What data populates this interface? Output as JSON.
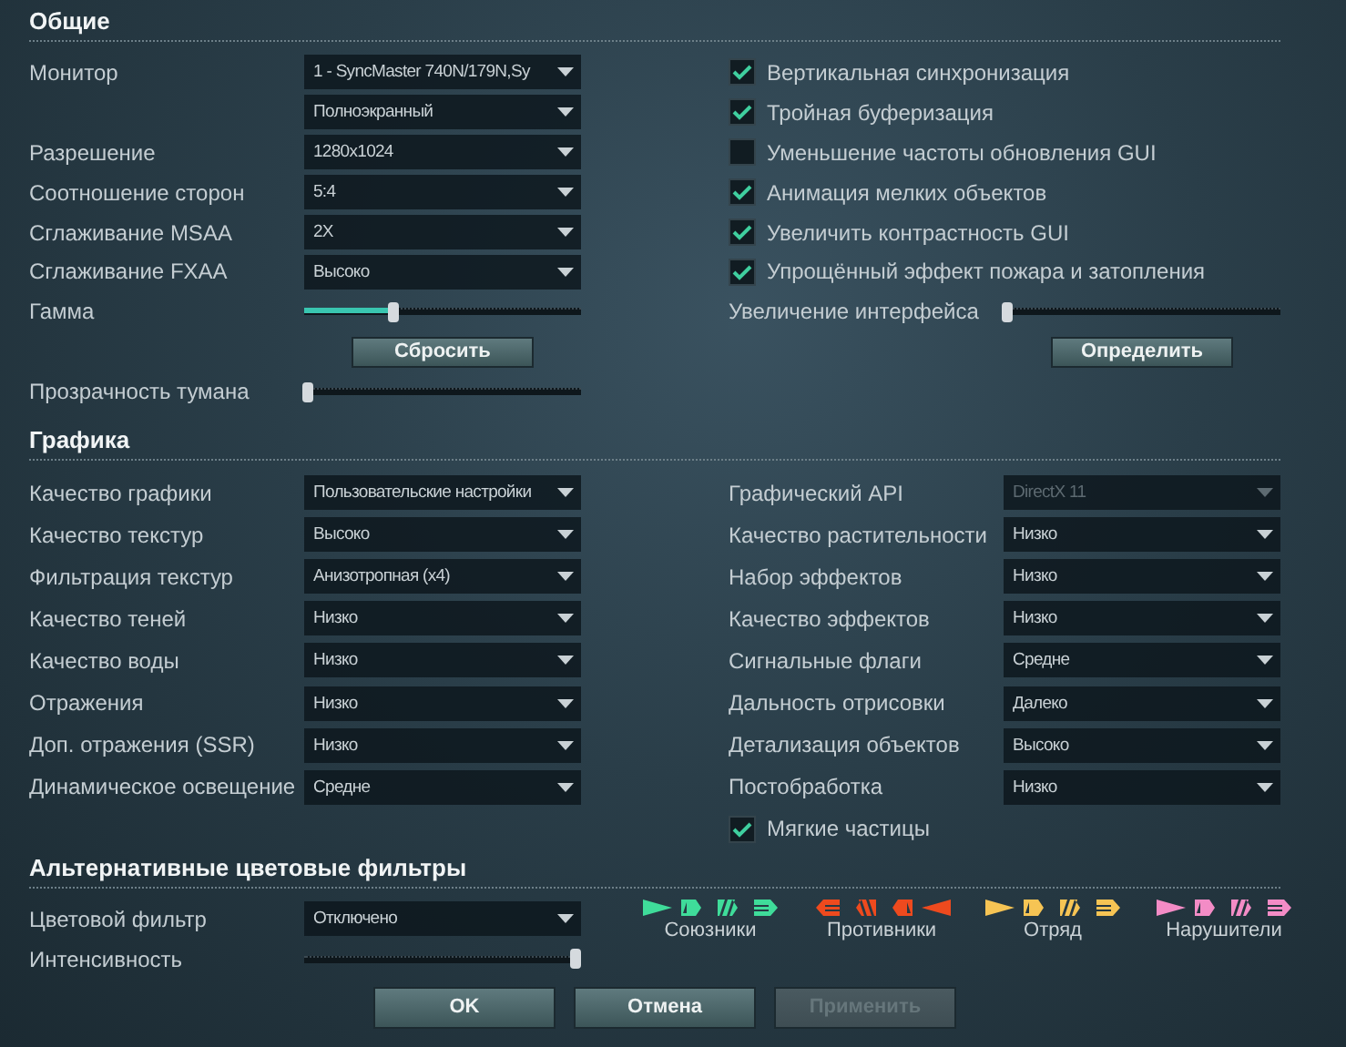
{
  "general": {
    "title": "Общие",
    "left": [
      {
        "kind": "select",
        "label": "Монитор",
        "value": "1 - SyncMaster 740N/179N,Sy"
      },
      {
        "kind": "select",
        "value": "Полноэкранный"
      },
      {
        "kind": "select",
        "label": "Разрешение",
        "value": "1280x1024"
      },
      {
        "kind": "select",
        "label": "Соотношение сторон",
        "value": "5:4"
      },
      {
        "kind": "select",
        "label": "Сглаживание MSAA",
        "value": "2X"
      },
      {
        "kind": "select",
        "label": "Сглаживание FXAA",
        "value": "Высоко"
      },
      {
        "kind": "slider",
        "label": "Гамма",
        "level": 0.32
      },
      {
        "kind": "button",
        "label": "Сбросить"
      },
      {
        "kind": "slider",
        "label": "Прозрачность тумана",
        "level": 0
      }
    ],
    "right": [
      {
        "kind": "checkbox",
        "label": "Вертикальная синхронизация",
        "checked": true
      },
      {
        "kind": "checkbox",
        "label": "Тройная буферизация",
        "checked": true
      },
      {
        "kind": "checkbox",
        "label": "Уменьшение частоты обновления GUI",
        "checked": false
      },
      {
        "kind": "checkbox",
        "label": "Анимация мелких объектов",
        "checked": true
      },
      {
        "kind": "checkbox",
        "label": "Увеличить контрастность GUI",
        "checked": true
      },
      {
        "kind": "checkbox",
        "label": "Упрощённый эффект пожара и затопления",
        "checked": true
      },
      {
        "kind": "slider",
        "label": "Увеличение интерфейса",
        "level": 0
      },
      {
        "kind": "button",
        "label": "Определить"
      }
    ]
  },
  "graphics": {
    "title": "Графика",
    "left": [
      {
        "kind": "select",
        "label": "Качество графики",
        "value": "Пользовательские настройки",
        "disabled": false
      },
      {
        "kind": "select",
        "label": "Качество текстур",
        "value": "Высоко",
        "disabled": false
      },
      {
        "kind": "select",
        "label": "Фильтрация текстур",
        "value": "Анизотропная (x4)",
        "disabled": false
      },
      {
        "kind": "select",
        "label": "Качество теней",
        "value": "Низко",
        "disabled": false
      },
      {
        "kind": "select",
        "label": "Качество воды",
        "value": "Низко",
        "disabled": false
      },
      {
        "kind": "select",
        "label": "Отражения",
        "value": "Низко",
        "disabled": false
      },
      {
        "kind": "select",
        "label": "Доп. отражения (SSR)",
        "value": "Низко",
        "disabled": false
      },
      {
        "kind": "select",
        "label": "Динамическое освещение",
        "value": "Средне",
        "disabled": false
      }
    ],
    "right": [
      {
        "kind": "select",
        "label": "Графический API",
        "value": "DirectX 11",
        "disabled": true
      },
      {
        "kind": "select",
        "label": "Качество растительности",
        "value": "Низко",
        "disabled": false
      },
      {
        "kind": "select",
        "label": "Набор эффектов",
        "value": "Низко",
        "disabled": false
      },
      {
        "kind": "select",
        "label": "Качество эффектов",
        "value": "Низко",
        "disabled": false
      },
      {
        "kind": "select",
        "label": "Сигнальные флаги",
        "value": "Средне",
        "disabled": false
      },
      {
        "kind": "select",
        "label": "Дальность отрисовки",
        "value": "Далеко",
        "disabled": false
      },
      {
        "kind": "select",
        "label": "Детализация объектов",
        "value": "Высоко",
        "disabled": false
      },
      {
        "kind": "select",
        "label": "Постобработка",
        "value": "Низко",
        "disabled": false
      },
      {
        "kind": "checkbox",
        "label": "Мягкие частицы",
        "checked": true
      }
    ]
  },
  "color_filters": {
    "title": "Альтернативные цветовые фильтры",
    "rows": [
      {
        "kind": "select",
        "label": "Цветовой фильтр",
        "value": "Отключено"
      },
      {
        "kind": "slider",
        "label": "Интенсивность",
        "level": 1
      }
    ],
    "legend": [
      {
        "label": "Союзники",
        "color": "#3fdc9a",
        "kind": "forward"
      },
      {
        "label": "Противники",
        "color": "#ee4a1e",
        "kind": "reversed"
      },
      {
        "label": "Отряд",
        "color": "#f6c454",
        "kind": "forward"
      },
      {
        "label": "Нарушители",
        "color": "#f38cc6",
        "kind": "forward"
      }
    ]
  },
  "buttons": [
    {
      "label": "OK",
      "disabled": false
    },
    {
      "label": "Отмена",
      "disabled": false
    },
    {
      "label": "Применить",
      "disabled": true
    }
  ]
}
